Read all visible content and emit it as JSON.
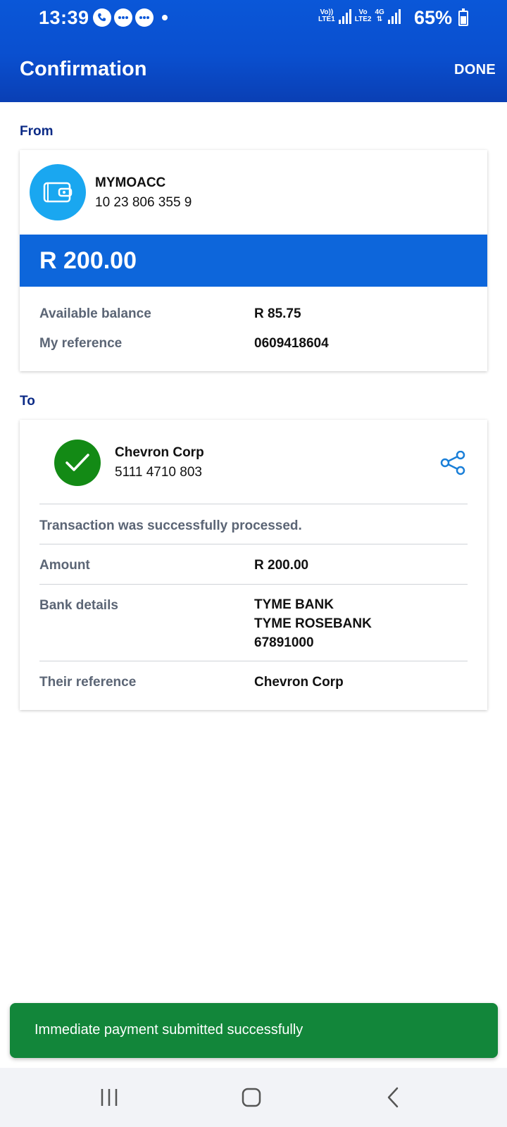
{
  "status_bar": {
    "time": "13:39",
    "sim1_label_top": "Vo))",
    "sim1_label_bottom": "LTE1",
    "sim2_label_top": "Vo",
    "sim2_label_bottom": "LTE2",
    "network_type": "4G",
    "battery": "65%"
  },
  "header": {
    "title": "Confirmation",
    "done_label": "DONE",
    "background_color": "#0a4fcf"
  },
  "from": {
    "section_label": "From",
    "account_name": "MYMOACC",
    "account_number": "10 23 806 355 9",
    "amount": "R 200.00",
    "available_balance_label": "Available balance",
    "available_balance_value": "R 85.75",
    "my_reference_label": "My reference",
    "my_reference_value": "0609418604"
  },
  "to": {
    "section_label": "To",
    "recipient_name": "Chevron Corp",
    "recipient_number": "5111 4710 803",
    "status_message": "Transaction was successfully processed.",
    "amount_label": "Amount",
    "amount_value": "R 200.00",
    "bank_details_label": "Bank details",
    "bank_details_lines": [
      "TYME BANK",
      "TYME ROSEBANK",
      "67891000"
    ],
    "their_reference_label": "Their reference",
    "their_reference_value": "Chevron Corp"
  },
  "snackbar": {
    "message": "Immediate payment submitted successfully",
    "color": "#12863a"
  },
  "icons": {
    "account": "wallet-icon",
    "success": "check-circle-icon",
    "share": "share-icon",
    "nav_recents": "recents-icon",
    "nav_home": "home-icon",
    "nav_back": "back-icon"
  }
}
